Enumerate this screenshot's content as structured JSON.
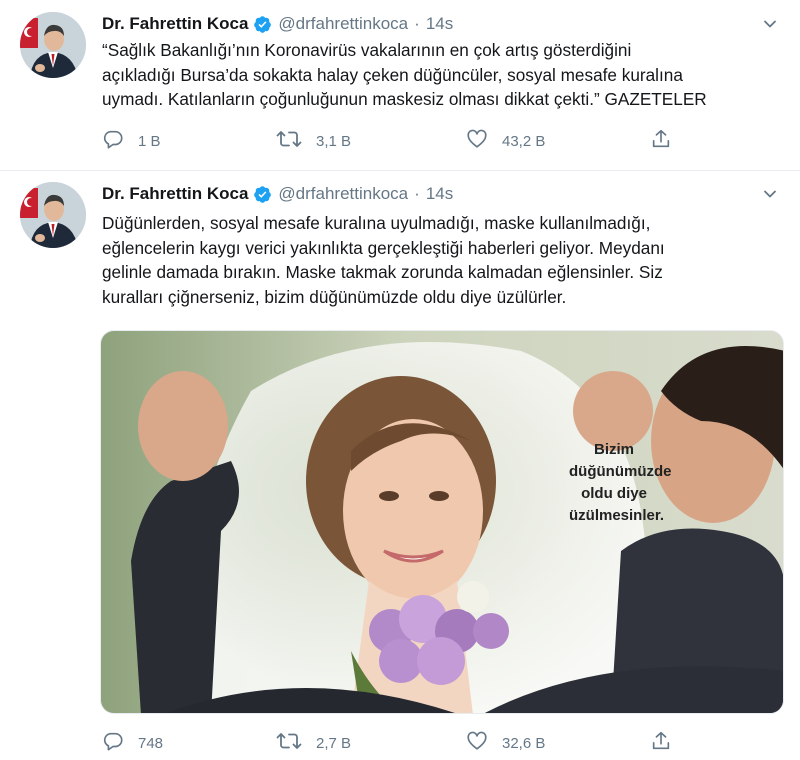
{
  "tweets": [
    {
      "author_name": "Dr. Fahrettin Koca",
      "handle": "@drfahrettinkoca",
      "separator": "·",
      "time": "14s",
      "text_lines": [
        "“Sağlık Bakanlığı’nın Koronavirüs vakalarının en çok artış gösterdiğini",
        "açıkladığı Bursa’da sokakta halay çeken düğüncüler, sosyal mesafe kuralına",
        "uymadı. Katılanların çoğunluğunun maskesiz olması dikkat çekti.” GAZETELER"
      ],
      "replies": "1 B",
      "retweets": "3,1 B",
      "likes": "43,2 B"
    },
    {
      "author_name": "Dr. Fahrettin Koca",
      "handle": "@drfahrettinkoca",
      "separator": "·",
      "time": "14s",
      "text_lines": [
        "Düğünlerden, sosyal mesafe kuralına uyulmadığı, maske kullanılmadığı,",
        "eğlencelerin kaygı verici yakınlıkta gerçekleştiği haberleri geliyor. Meydanı",
        "gelinle damada bırakın. Maske takmak zorunda kalmadan eğlensinler. Siz",
        "kuralları çiğnerseniz, bizim düğünümüzde oldu diye üzülürler."
      ],
      "media": {
        "overlay_lines": [
          "Bizim",
          "düğünümüzde",
          "oldu diye",
          "üzülmesinler."
        ]
      },
      "replies": "748",
      "retweets": "2,7 B",
      "likes": "32,6 B"
    }
  ],
  "icons": {
    "verified": "verified-badge-icon",
    "more": "chevron-down-icon",
    "reply": "reply-icon",
    "retweet": "retweet-icon",
    "like": "heart-icon",
    "share": "share-icon"
  },
  "colors": {
    "accent": "#1da1f2",
    "secondary_text": "#657786",
    "divider": "#e6ecf0",
    "primary_text": "#14171a"
  }
}
